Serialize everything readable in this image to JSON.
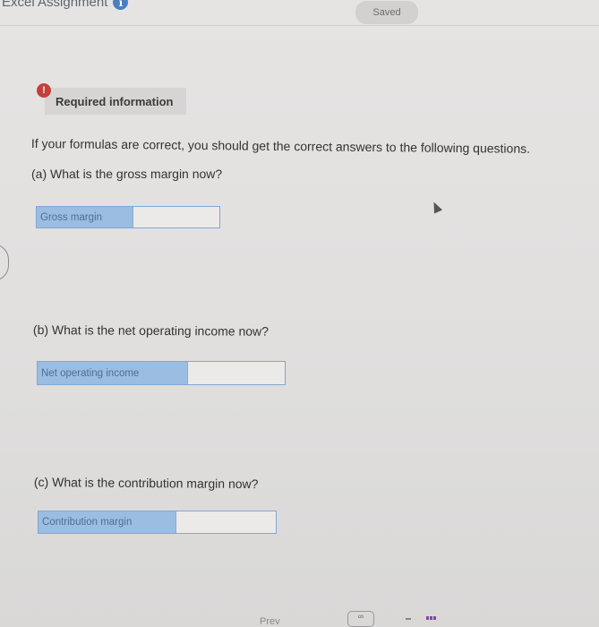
{
  "header": {
    "title": "Excel Assignment",
    "info_icon": "info-icon",
    "saved_label": "Saved"
  },
  "required": {
    "alert_icon": "exclamation-icon",
    "label": "Required information"
  },
  "instruction": "If your formulas are correct, you should get the correct answers to the following questions.",
  "questions": [
    {
      "prompt": "(a) What is the gross margin now?",
      "field_label": "Gross margin",
      "value": ""
    },
    {
      "prompt": "(b) What is the net operating income now?",
      "field_label": "Net operating income",
      "value": ""
    },
    {
      "prompt": "(c) What is the contribution margin now?",
      "field_label": "Contribution margin",
      "value": ""
    }
  ],
  "footer": {
    "prev_label": "Prev",
    "page_icon": "page-link-icon",
    "grid_icon": "grid-icon"
  }
}
